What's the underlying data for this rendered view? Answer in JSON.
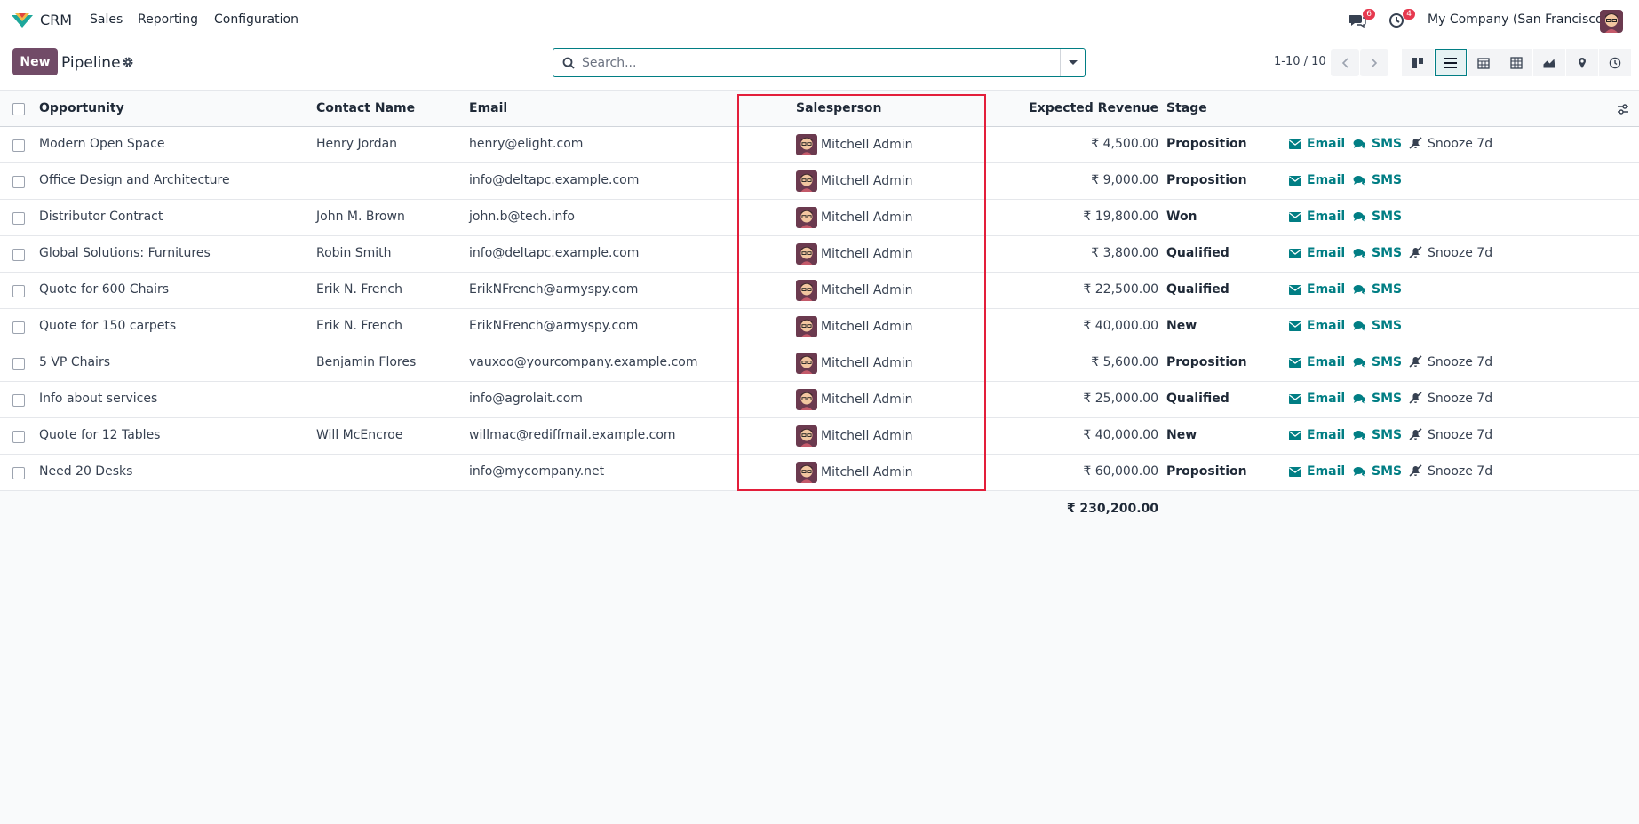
{
  "nav": {
    "app_name": "CRM",
    "menus": [
      "Sales",
      "Reporting",
      "Configuration"
    ],
    "messages_badge": "6",
    "activities_badge": "4",
    "company": "My Company (San Francisco)",
    "icons": [
      "crm-logo",
      "chat-icon",
      "clock-icon",
      "user-avatar"
    ]
  },
  "control": {
    "new_label": "New",
    "title": "Pipeline",
    "search_placeholder": "Search...",
    "pager": "1-10 / 10",
    "views": [
      "kanban",
      "list",
      "calendar",
      "pivot",
      "graph",
      "map",
      "activity"
    ],
    "active_view": "list"
  },
  "columns": {
    "opportunity": "Opportunity",
    "contact": "Contact Name",
    "email": "Email",
    "salesperson": "Salesperson",
    "revenue": "Expected Revenue",
    "stage": "Stage"
  },
  "actions": {
    "email": "Email",
    "sms": "SMS",
    "snooze": "Snooze 7d"
  },
  "rows": [
    {
      "opportunity": "Modern Open Space",
      "contact": "Henry Jordan",
      "email": "henry@elight.com",
      "salesperson": "Mitchell Admin",
      "revenue": "₹ 4,500.00",
      "stage": "Proposition",
      "snooze": true
    },
    {
      "opportunity": "Office Design and Architecture",
      "contact": "",
      "email": "info@deltapc.example.com",
      "salesperson": "Mitchell Admin",
      "revenue": "₹ 9,000.00",
      "stage": "Proposition",
      "snooze": false
    },
    {
      "opportunity": "Distributor Contract",
      "contact": "John M. Brown",
      "email": "john.b@tech.info",
      "salesperson": "Mitchell Admin",
      "revenue": "₹ 19,800.00",
      "stage": "Won",
      "snooze": false
    },
    {
      "opportunity": "Global Solutions: Furnitures",
      "contact": "Robin Smith",
      "email": "info@deltapc.example.com",
      "salesperson": "Mitchell Admin",
      "revenue": "₹ 3,800.00",
      "stage": "Qualified",
      "snooze": true
    },
    {
      "opportunity": "Quote for 600 Chairs",
      "contact": "Erik N. French",
      "email": "ErikNFrench@armyspy.com",
      "salesperson": "Mitchell Admin",
      "revenue": "₹ 22,500.00",
      "stage": "Qualified",
      "snooze": false
    },
    {
      "opportunity": "Quote for 150 carpets",
      "contact": "Erik N. French",
      "email": "ErikNFrench@armyspy.com",
      "salesperson": "Mitchell Admin",
      "revenue": "₹ 40,000.00",
      "stage": "New",
      "snooze": false
    },
    {
      "opportunity": "5 VP Chairs",
      "contact": "Benjamin Flores",
      "email": "vauxoo@yourcompany.example.com",
      "salesperson": "Mitchell Admin",
      "revenue": "₹ 5,600.00",
      "stage": "Proposition",
      "snooze": true
    },
    {
      "opportunity": "Info about services",
      "contact": "",
      "email": "info@agrolait.com",
      "salesperson": "Mitchell Admin",
      "revenue": "₹ 25,000.00",
      "stage": "Qualified",
      "snooze": true
    },
    {
      "opportunity": "Quote for 12 Tables",
      "contact": "Will McEncroe",
      "email": "willmac@rediffmail.example.com",
      "salesperson": "Mitchell Admin",
      "revenue": "₹ 40,000.00",
      "stage": "New",
      "snooze": true
    },
    {
      "opportunity": "Need 20 Desks",
      "contact": "",
      "email": "info@mycompany.net",
      "salesperson": "Mitchell Admin",
      "revenue": "₹ 60,000.00",
      "stage": "Proposition",
      "snooze": true
    }
  ],
  "total_revenue": "₹ 230,200.00",
  "colors": {
    "primary": "#714b67",
    "accent": "#017e84",
    "highlight": "#e31e3a",
    "badge": "#e6394f"
  }
}
